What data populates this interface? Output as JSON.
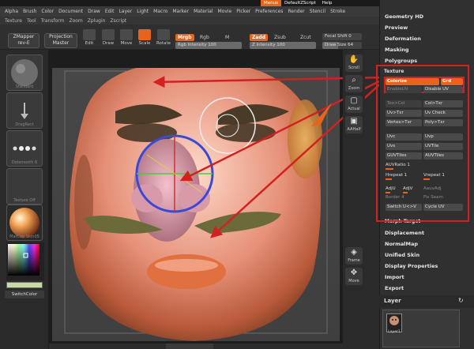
{
  "menu_top": {
    "tabs": [
      "Menus",
      "DefaultZScript",
      "Help"
    ],
    "active_tab": "Menus"
  },
  "menu_row1": [
    "Alpha",
    "Brush",
    "Color",
    "Document",
    "Draw",
    "Edit",
    "Layer",
    "Light",
    "Macro",
    "Marker",
    "Material",
    "Movie",
    "Picker",
    "Preferences",
    "Render",
    "Stencil",
    "Stroke"
  ],
  "menu_row2": [
    "Texture",
    "Tool",
    "Transform",
    "Zoom",
    "Zplugin",
    "Zscript"
  ],
  "shelf": {
    "zmapper": "ZMapper",
    "zmapper_sub": "rev-E",
    "projection": "Projection",
    "projection_sub": "Master",
    "tools": [
      "Edit",
      "Draw",
      "Move",
      "Scale",
      "Rotate"
    ],
    "active_tool": "Scale",
    "mrgb": "Mrgb",
    "rgb": "Rgb",
    "m": "M",
    "rgb_intensity_label": "Rgb Intensity",
    "rgb_intensity_value": "100",
    "zadd": "Zadd",
    "zsub": "Zsub",
    "zcut": "Zcut",
    "z_intensity_label": "Z Intensity",
    "z_intensity_value": "100",
    "focal_shift_label": "Focal Shift",
    "focal_shift_value": "0",
    "draw_size_label": "Draw Size",
    "draw_size_value": "64"
  },
  "left_tray": {
    "brush_label": "Standard",
    "stroke_label": "DragRect",
    "alpha_label": "Dotsmooth 6",
    "texture_label": "Texture Off",
    "material_label": "MatCap Skin05",
    "switch_color": "SwitchColor"
  },
  "right_shelf": [
    "Scroll",
    "Zoom",
    "Actual",
    "AAHalf",
    "Frame",
    "Move"
  ],
  "palette": {
    "items_top": [
      "Geometry HD",
      "Preview",
      "Deformation",
      "Masking",
      "Polygroups"
    ],
    "items_bottom": [
      "Morph Target",
      "Displacement",
      "NormalMap",
      "Unified Skin",
      "Display Properties",
      "Import",
      "Export"
    ],
    "texture": {
      "title": "Texture",
      "colorize": "Colorize",
      "grd": "Grd",
      "enable_uv": "EnableUV",
      "disable_uv": "Disable UV",
      "tex_col": "Tex>Col",
      "col_txr": "Col>Txr",
      "uv_txr": "Uv>Txr",
      "uv_check": "Uv Check",
      "vertex_txr": "Vertex>Txr",
      "poly_txr": "Poly>Txr",
      "uvc": "Uvc",
      "uvp": "Uvp",
      "uvs": "Uvs",
      "uvtile": "UVTile",
      "guvtiles": "GUVTiles",
      "auvtiles": "AUVTiles",
      "auvratio": "AUVRatio 1",
      "hrepeat": "Hrepeat 1",
      "vrepeat": "Vrepeat 1",
      "adju": "AdjU",
      "adjv": "AdjV",
      "auvadj": "AauvAdj",
      "border": "Border 4",
      "fix_seam": "Fix Seam",
      "switch_uv": "Switch U<>V",
      "cycle_uv": "Cycle UV"
    },
    "layer_title": "Layer",
    "layer_thumb_label": "Layer1"
  },
  "colors": {
    "accent": "#e8641c",
    "highlight_box": "#d42020",
    "panel_bg": "#303030"
  }
}
